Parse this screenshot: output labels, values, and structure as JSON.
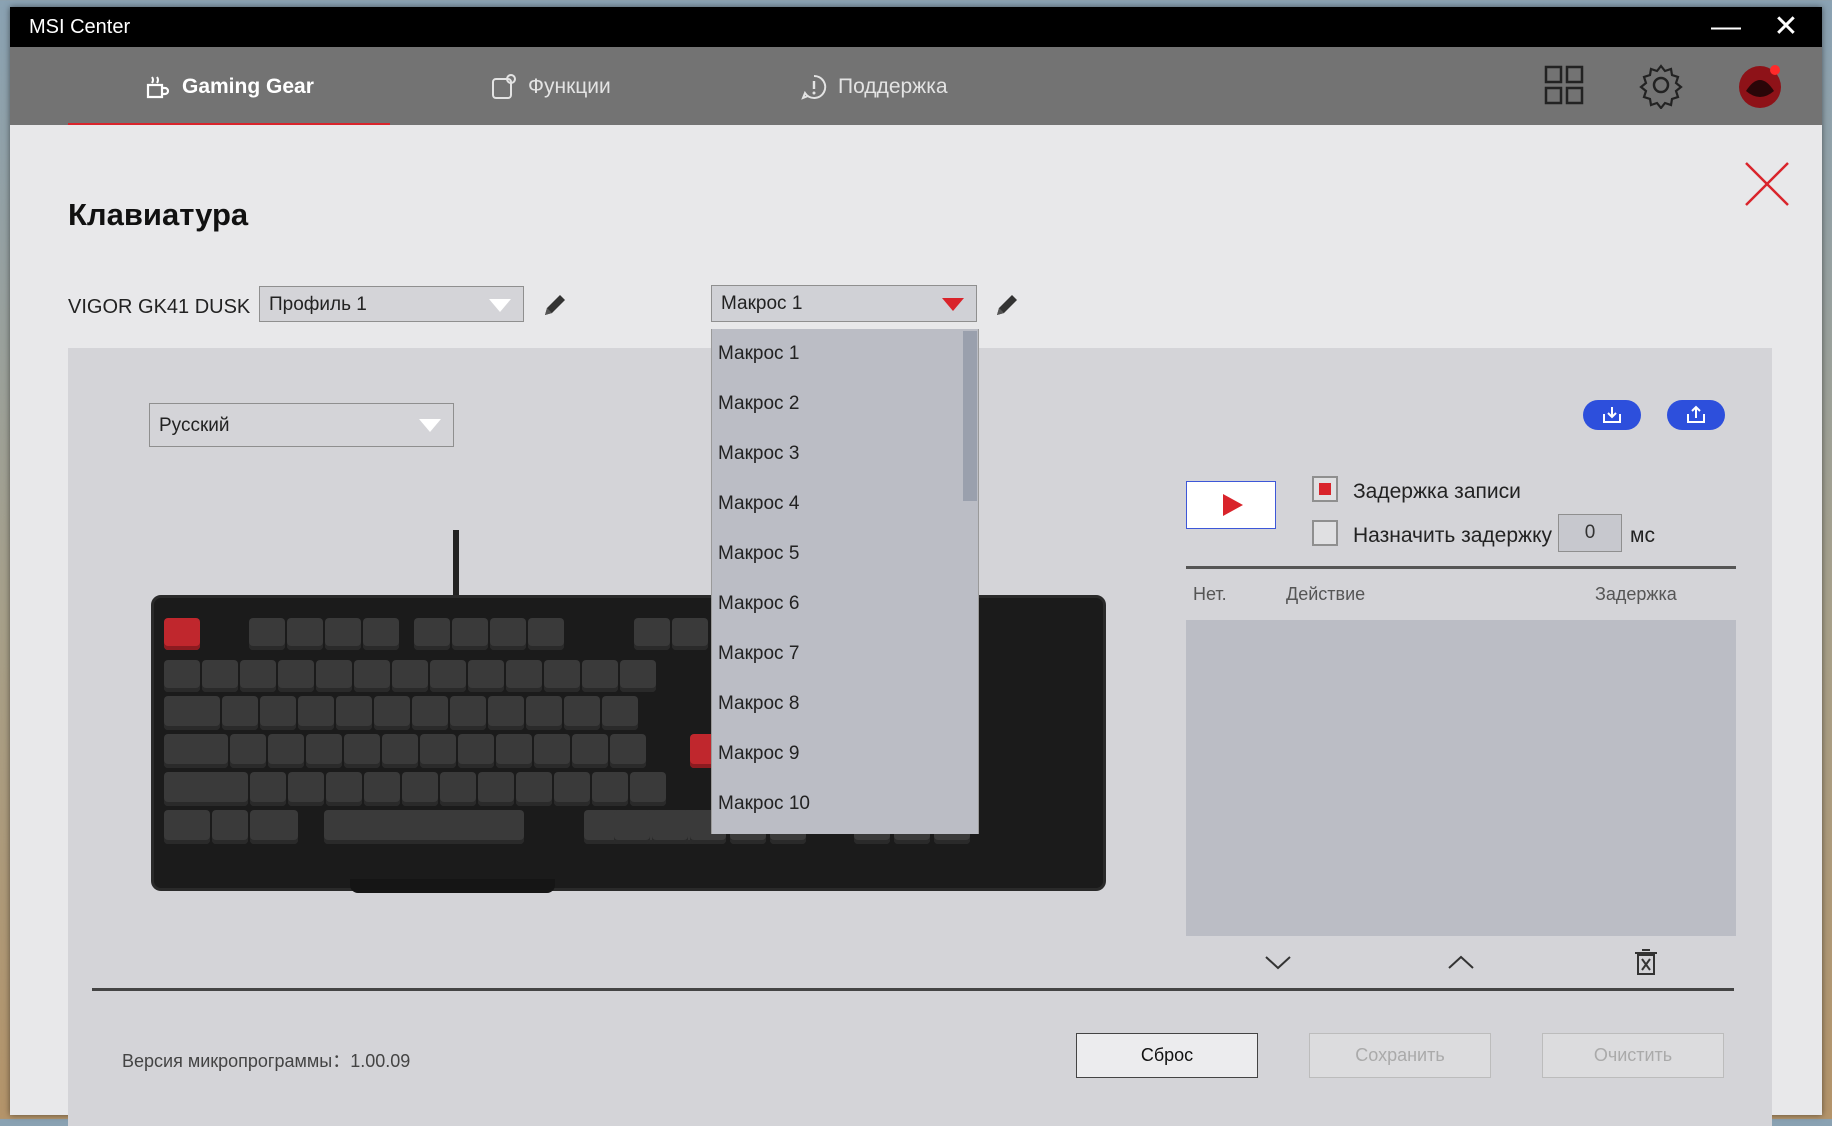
{
  "window": {
    "title": "MSI Center",
    "minimize": "—",
    "close": "✕"
  },
  "nav": {
    "tabs": [
      {
        "label": "Gaming Gear",
        "icon": "gaming-gear-icon",
        "active": true
      },
      {
        "label": "Функции",
        "icon": "functions-icon",
        "active": false
      },
      {
        "label": "Поддержка",
        "icon": "support-icon",
        "active": false
      }
    ],
    "right_icons": [
      "grid-icon",
      "gear-icon",
      "avatar"
    ]
  },
  "page": {
    "title": "Клавиатура"
  },
  "device": {
    "name": "VIGOR GK41 DUSK"
  },
  "profile_select": {
    "value": "Профиль 1"
  },
  "macro_select": {
    "value": "Макрос 1",
    "options": [
      "Макрос 1",
      "Макрос 2",
      "Макрос 3",
      "Макрос 4",
      "Макрос 5",
      "Макрос 6",
      "Макрос 7",
      "Макрос 8",
      "Макрос 9",
      "Макрос 10"
    ]
  },
  "language_select": {
    "value": "Русский"
  },
  "recording": {
    "record_delay_label": "Задержка записи",
    "record_delay_checked": true,
    "assign_delay_label": "Назначить задержку",
    "assign_delay_checked": false,
    "delay_value": "0",
    "delay_unit": "мс"
  },
  "macro_table": {
    "columns": [
      "Нет.",
      "Действие",
      "Задержка"
    ],
    "rows": []
  },
  "footer": {
    "firmware": "Версия микропрограммы：1.00.09",
    "reset_label": "Сброс",
    "save_label": "Сохранить",
    "clear_label": "Очистить"
  },
  "colors": {
    "accent": "#d9242b",
    "blue": "#2d4fdc",
    "nav_bg": "#737373"
  }
}
